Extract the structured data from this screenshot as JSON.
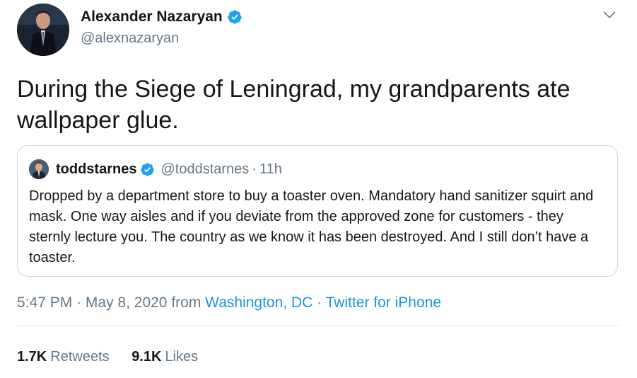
{
  "author": {
    "name": "Alexander Nazaryan",
    "handle": "@alexnazaryan",
    "verified": true
  },
  "tweet": {
    "text": "During the Siege of Leningrad, my grandparents ate wallpaper glue."
  },
  "quoted_tweet": {
    "name": "toddstarnes",
    "handle": "@toddstarnes",
    "separator": "·",
    "time": "11h",
    "verified": true,
    "text": "Dropped by a department store to buy a toaster oven. Mandatory hand sanitizer squirt and mask. One way aisles and if you deviate from the approved zone for customers - they sternly lecture you. The country as we know it has been destroyed. And I still don’t have a toaster."
  },
  "meta": {
    "time": "5:47 PM",
    "sep1": "·",
    "date": "May 8, 2020",
    "from": "from",
    "location": "Washington, DC",
    "sep2": "·",
    "source": "Twitter for iPhone"
  },
  "stats": {
    "retweets_count": "1.7K",
    "retweets_label": "Retweets",
    "likes_count": "9.1K",
    "likes_label": "Likes"
  },
  "colors": {
    "link": "#1b95e0",
    "verified": "#1da1f2",
    "secondary_text": "#657786",
    "border": "#ccd6dd"
  }
}
